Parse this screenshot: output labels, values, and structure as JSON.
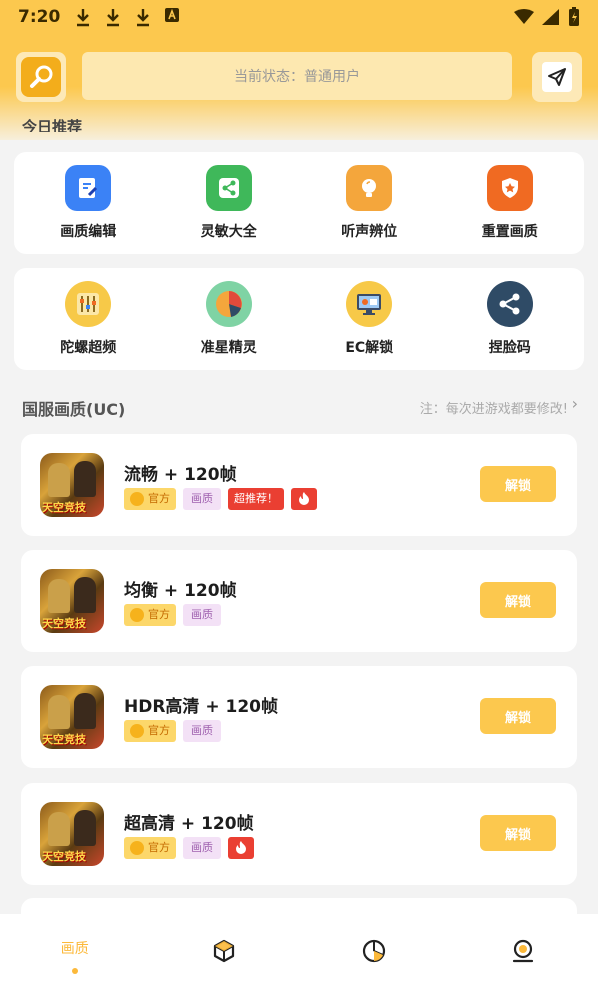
{
  "status_bar": {
    "time": "7:20"
  },
  "header": {
    "status_text": "当前状态：普通用户"
  },
  "section_recommend": {
    "title": "今日推荐"
  },
  "grid1": [
    {
      "label": "画质编辑",
      "icon": "edit-icon",
      "color": "#3b82f6"
    },
    {
      "label": "灵敏大全",
      "icon": "share-icon",
      "color": "#3fb85a"
    },
    {
      "label": "听声辨位",
      "icon": "bulb-icon",
      "color": "#f4a63c"
    },
    {
      "label": "重置画质",
      "icon": "shield-star-icon",
      "color": "#f06a22"
    }
  ],
  "grid2": [
    {
      "label": "陀螺超频",
      "icon": "equalizer-icon",
      "color": "#f7c948"
    },
    {
      "label": "准星精灵",
      "icon": "pie-icon",
      "color": "#7fd3a4"
    },
    {
      "label": "EC解锁",
      "icon": "monitor-icon",
      "color": "#f7c948"
    },
    {
      "label": "捏脸码",
      "icon": "share-circle-icon",
      "color": "#2f4b66"
    }
  ],
  "list": {
    "title": "国服画质(UC)",
    "note": "注：每次进游戏都要修改!",
    "tag_official": "官方",
    "tag_quality": "画质",
    "tag_reco": "超推荐！",
    "unlock_label": "解锁",
    "thumb_text": "天空竞技",
    "items": [
      {
        "title": "流畅 + 120帧"
      },
      {
        "title": "均衡 + 120帧"
      },
      {
        "title": "HDR高清 + 120帧"
      },
      {
        "title": "超高清 + 120帧"
      }
    ]
  },
  "nav": {
    "tab1": "画质"
  },
  "colors": {
    "accent": "#fcc84e",
    "hot": "#ea3f32"
  }
}
